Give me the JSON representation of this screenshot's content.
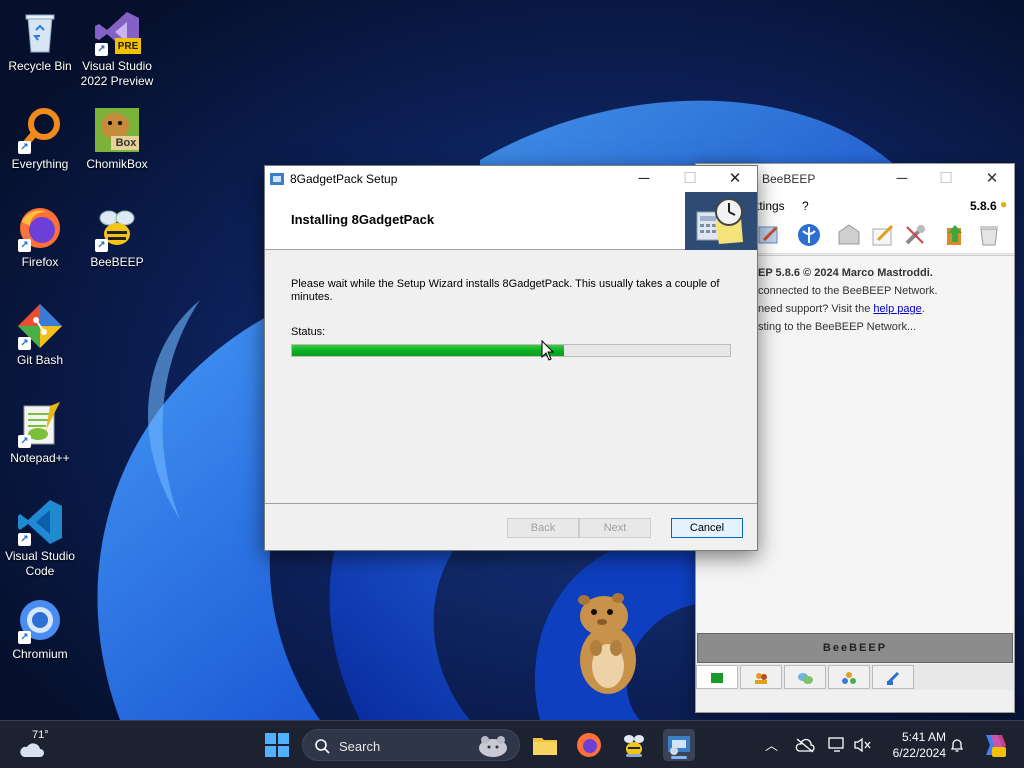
{
  "desktop": {
    "icons": [
      {
        "label": "Recycle Bin"
      },
      {
        "label": "Visual Studio 2022 Preview"
      },
      {
        "label": "Everything"
      },
      {
        "label": "ChomikBox"
      },
      {
        "label": "Firefox"
      },
      {
        "label": "BeeBEEP"
      },
      {
        "label": "Git Bash"
      },
      {
        "label": "Notepad++"
      },
      {
        "label": "Visual Studio Code"
      },
      {
        "label": "Chromium"
      }
    ],
    "badges": {
      "vs_preview": "PRE",
      "chomikbox": "Box"
    }
  },
  "beebeep": {
    "title": "BeeBEEP",
    "menu": {
      "settings": "ttings",
      "help": "?",
      "version": "5.8.6"
    },
    "chat": {
      "line1": "EP 5.8.6 © 2024 Marco Mastroddi.",
      "line2": " connected to the BeeBEEP Network.",
      "line3_prefix": "need support? Visit the ",
      "line3_link": "help page",
      "line3_suffix": ".",
      "line4": "sting to the BeeBEEP Network..."
    },
    "brand": "BeeBEEP"
  },
  "setup": {
    "title": "8GadgetPack Setup",
    "heading": "Installing 8GadgetPack",
    "description": "Please wait while the Setup Wizard installs 8GadgetPack. This usually takes a couple of minutes.",
    "status_label": "Status:",
    "progress_percent": 62,
    "buttons": {
      "back": "Back",
      "next": "Next",
      "cancel": "Cancel"
    }
  },
  "taskbar": {
    "weather_temp": "71°",
    "search_label": "Search",
    "clock_time": "5:41 AM",
    "clock_date": "6/22/2024"
  },
  "colors": {
    "progress_fill": "#06b025",
    "taskbar_bg": "#1c2230",
    "link": "#0000cc"
  }
}
